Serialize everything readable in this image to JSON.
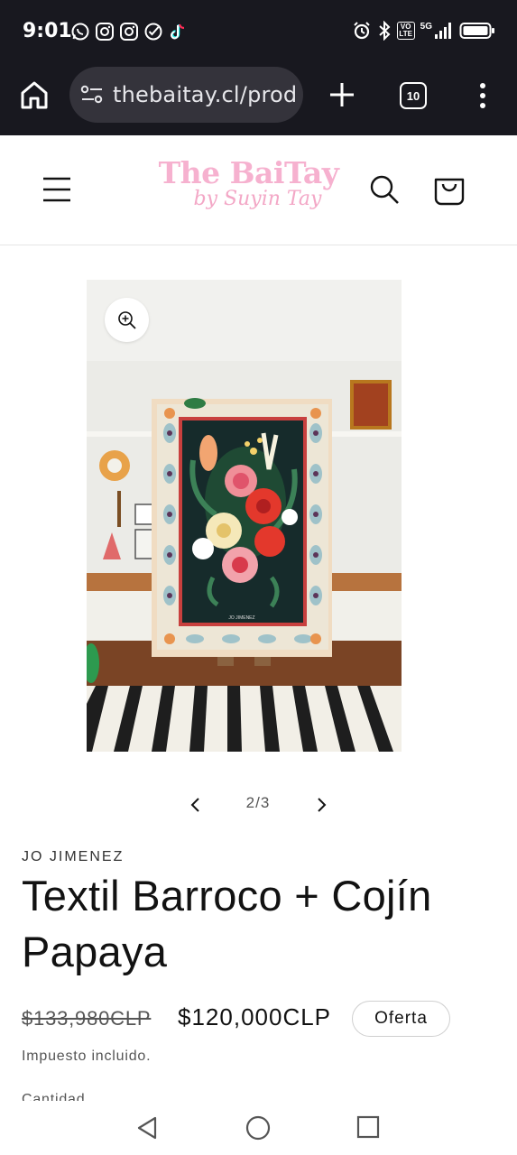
{
  "status_bar": {
    "time": "9:01",
    "app_icons": [
      "whatsapp-icon",
      "instagram-icon",
      "instagram-icon",
      "check-circle-icon",
      "tiktok-icon"
    ],
    "network_badge": "VO LTE",
    "network_type": "5G",
    "system_icons": [
      "alarm-icon",
      "bluetooth-icon",
      "signal-icon",
      "battery-icon"
    ]
  },
  "browser": {
    "url": "thebaitay.cl/prod",
    "tab_count": "10"
  },
  "site": {
    "logo_main": "The BaiTay",
    "logo_sub": "by Suyin Tay",
    "brand_color": "#f6b1cf"
  },
  "gallery": {
    "counter": "2/3"
  },
  "product": {
    "vendor": "JO JIMENEZ",
    "title": "Textil Barroco + Cojín Papaya",
    "compare_price": "$133,980CLP",
    "sale_price": "$120,000CLP",
    "badge": "Oferta",
    "tax_note": "Impuesto incluido.",
    "quantity_label": "Cantidad"
  }
}
